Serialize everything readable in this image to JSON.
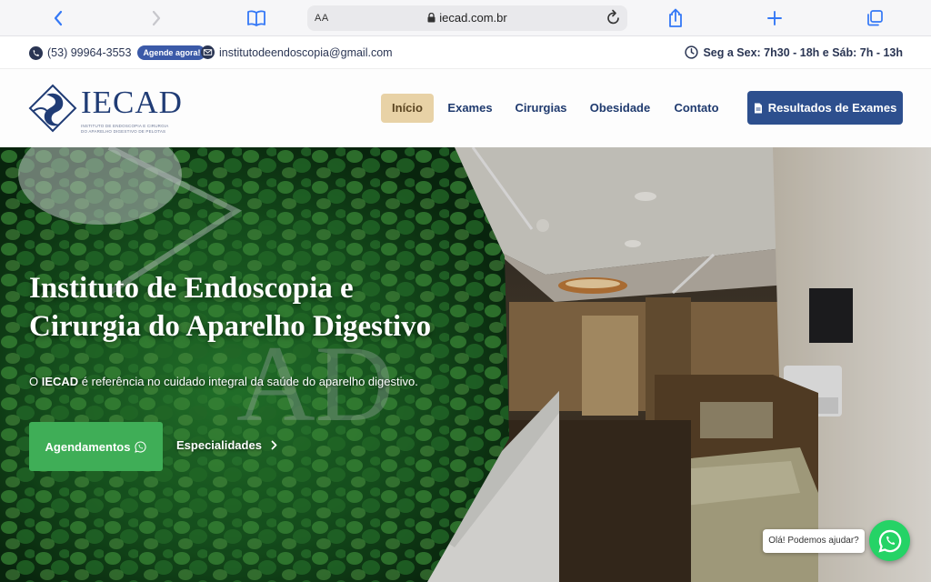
{
  "browser": {
    "text_size_label": "AA",
    "url": "iecad.com.br"
  },
  "topbar": {
    "phone": "(53) 99964-3553",
    "agende_badge": "Agende agora!",
    "email": "institutodeendoscopia@gmail.com",
    "hours": "Seg a Sex: 7h30 - 18h e Sáb: 7h - 13h"
  },
  "nav": {
    "logo_text": "IECAD",
    "logo_sub1": "INSTITUTO DE ENDOSCOPIA E CIRURGIA",
    "logo_sub2": "DO APARELHO DIGESTIVO DE PELOTAS",
    "items": [
      {
        "label": "Início",
        "active": true
      },
      {
        "label": "Exames"
      },
      {
        "label": "Cirurgias"
      },
      {
        "label": "Obesidade"
      },
      {
        "label": "Contato"
      }
    ],
    "results_button": "Resultados de Exames",
    "accent": "#2d4f8e",
    "active_color": "#e8d2a6"
  },
  "hero": {
    "title_line1": "Instituto de Endoscopia e",
    "title_line2": "Cirurgia do Aparelho Digestivo",
    "desc_prefix": "O ",
    "desc_brand": "IECAD",
    "desc_rest": " é referência no cuidado integral da saúde do aparelho digestivo.",
    "primary_button": "Agendamentos",
    "secondary_link": "Especialidades"
  },
  "chat": {
    "bubble": "Olá! Podemos ajudar?",
    "color": "#25d366"
  }
}
